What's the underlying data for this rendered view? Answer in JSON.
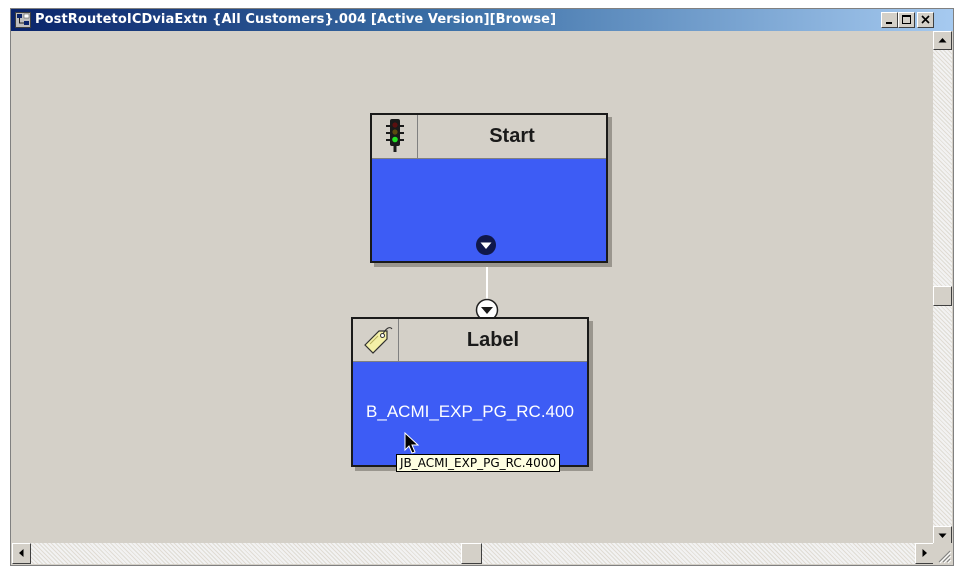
{
  "window": {
    "title": "PostRoutetoICDviaExtn {All Customers}.004 [Active Version][Browse]",
    "controls": [
      "minimize-icon",
      "maximize-icon",
      "close-icon"
    ]
  },
  "colors": {
    "node_body": "#3d5cf5",
    "canvas": "#d4d0c8",
    "title_bar": "#0a246a"
  },
  "nodes": {
    "start": {
      "title": "Start",
      "icon": "traffic-light-icon",
      "connector": "output-arrow-icon"
    },
    "label": {
      "title": "Label",
      "icon": "tag-icon",
      "value": "B_ACMI_EXP_PG_RC.400",
      "connector": "input-arrow-icon"
    }
  },
  "tooltip": {
    "text": "JB_ACMI_EXP_PG_RC.4000"
  },
  "cursor": "mouse-pointer-icon"
}
